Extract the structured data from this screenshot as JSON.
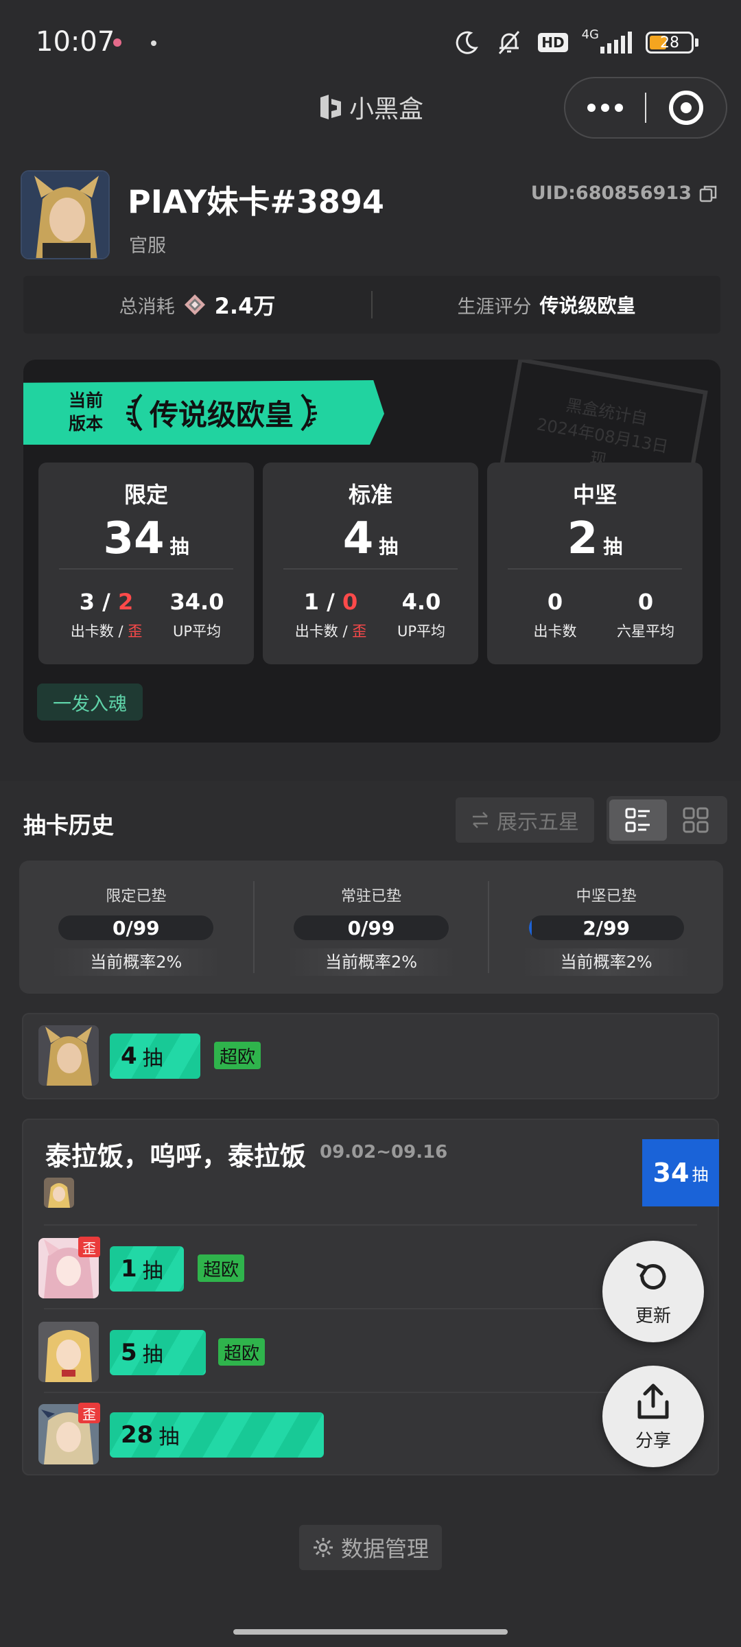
{
  "status_bar": {
    "time": "10:07",
    "hd": "HD",
    "network": "4G",
    "battery": "28"
  },
  "header": {
    "app_title": "小黑盒"
  },
  "profile": {
    "username": "PIAY妹卡#3894",
    "server": "官服",
    "uid": "UID:680856913"
  },
  "stats": {
    "total_cost_label": "总消耗",
    "total_cost_value": "2.4万",
    "career_label": "生涯评分",
    "career_value": "传说级欧皇"
  },
  "summary": {
    "version_label_1": "当前",
    "version_label_2": "版本",
    "rank_title": "传说级欧皇",
    "stamp_line1": "黑盒统计自",
    "stamp_line2": "2024年08月13日",
    "stamp_line3": "现",
    "pools": [
      {
        "name": "限定",
        "count": "34",
        "unit": "抽",
        "stat1_main": "3",
        "stat1_sep": " / ",
        "stat1_red": "2",
        "stat1_label": "出卡数 / ",
        "stat1_label_red": "歪",
        "stat2_value": "34.0",
        "stat2_label": "UP平均"
      },
      {
        "name": "标准",
        "count": "4",
        "unit": "抽",
        "stat1_main": "1",
        "stat1_sep": " / ",
        "stat1_red": "0",
        "stat1_label": "出卡数 / ",
        "stat1_label_red": "歪",
        "stat2_value": "4.0",
        "stat2_label": "UP平均"
      },
      {
        "name": "中坚",
        "count": "2",
        "unit": "抽",
        "stat1_value": "0",
        "stat1_label": "出卡数",
        "stat2_value": "0",
        "stat2_label": "六星平均"
      }
    ],
    "badge": "一发入魂"
  },
  "history": {
    "title": "抽卡历史",
    "show_five_star": "展示五星",
    "pity": [
      {
        "label": "限定已垫",
        "value": "0/99",
        "fill": 0,
        "rate": "当前概率2%"
      },
      {
        "label": "常驻已垫",
        "value": "0/99",
        "fill": 0,
        "rate": "当前概率2%"
      },
      {
        "label": "中坚已垫",
        "value": "2/99",
        "fill": 0.02,
        "rate": "当前概率2%"
      }
    ],
    "single_entry": {
      "count": "4",
      "unit": "抽",
      "tag": "超欧"
    },
    "banner": {
      "name": "泰拉饭，呜呼，泰拉饭",
      "date": "09.02~09.16",
      "total": "34",
      "total_unit": "抽",
      "rows": [
        {
          "count": "1",
          "unit": "抽",
          "tag": "超欧",
          "wai": "歪"
        },
        {
          "count": "5",
          "unit": "抽",
          "tag": "超欧"
        },
        {
          "count": "28",
          "unit": "抽",
          "wai": "歪"
        }
      ]
    }
  },
  "actions": {
    "refresh": "更新",
    "share": "分享",
    "data_manage": "数据管理"
  }
}
